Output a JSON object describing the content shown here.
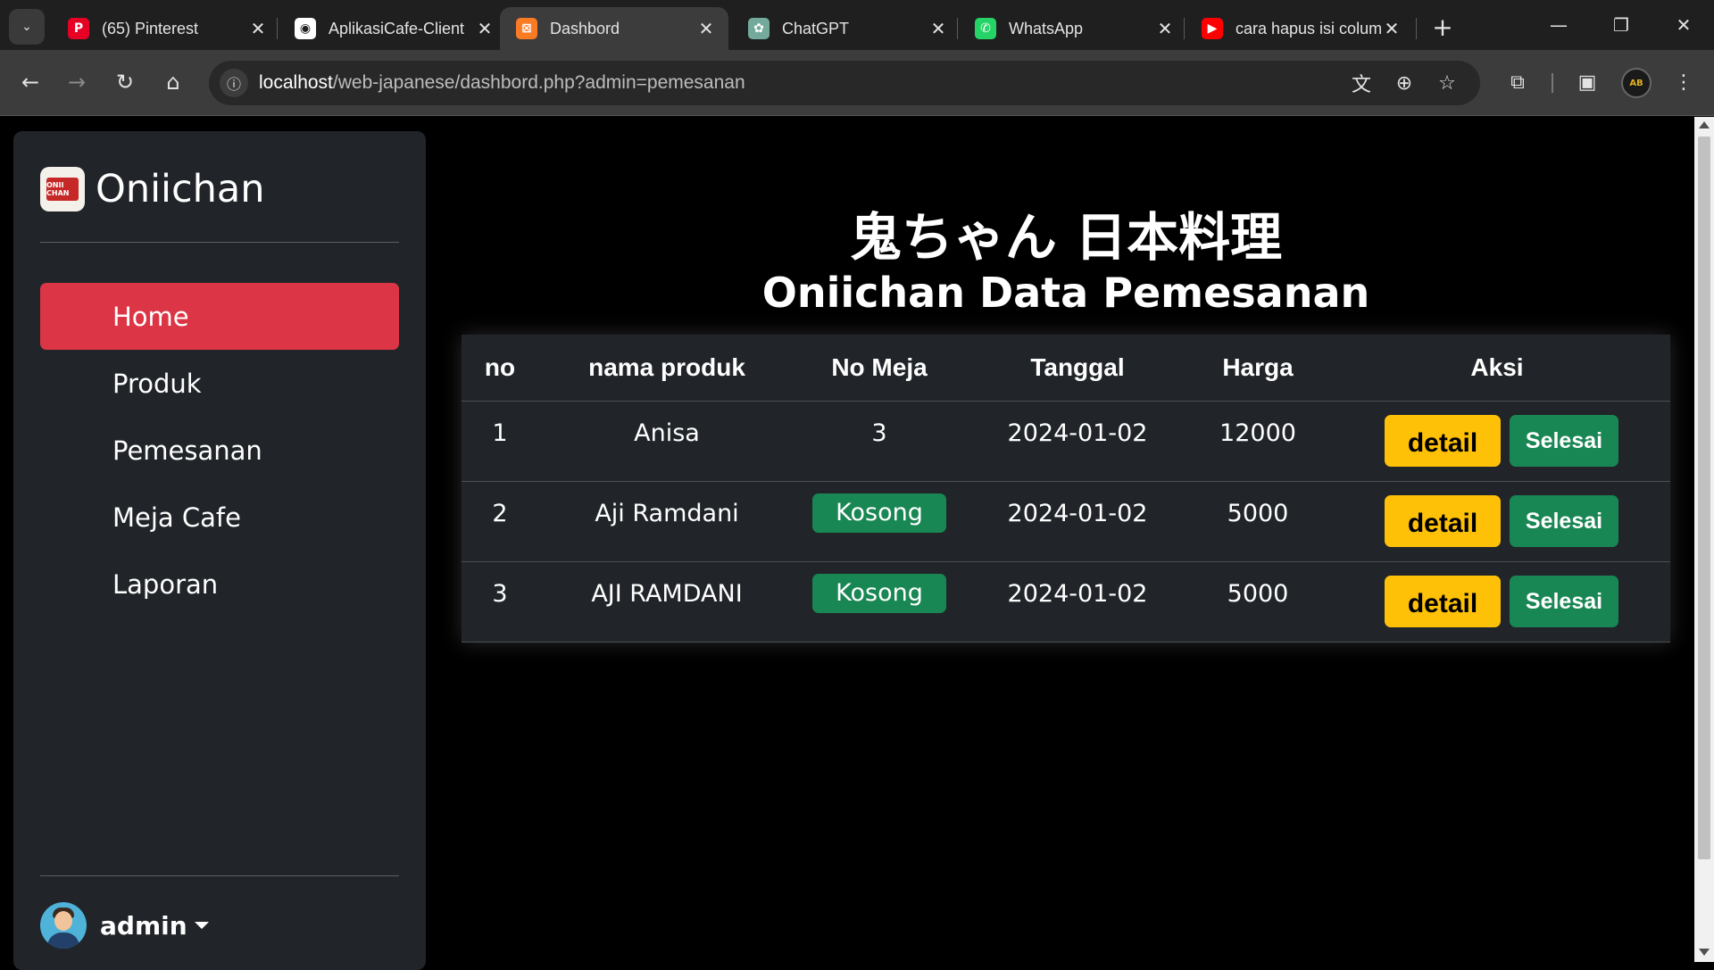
{
  "browser": {
    "tabs": [
      {
        "title": "(65) Pinterest",
        "icon": "pinterest-icon",
        "color": "#e60023"
      },
      {
        "title": "AplikasiCafe-Client",
        "icon": "github-icon",
        "color": "#ffffff"
      },
      {
        "title": "Dashbord",
        "icon": "xampp-icon",
        "color": "#fb7a24"
      },
      {
        "title": "ChatGPT",
        "icon": "chatgpt-icon",
        "color": "#74aa9c"
      },
      {
        "title": "WhatsApp",
        "icon": "whatsapp-icon",
        "color": "#25d366"
      },
      {
        "title": "cara hapus isi colum",
        "icon": "youtube-icon",
        "color": "#ff0000"
      }
    ],
    "active_tab_index": 2,
    "url_host": "localhost",
    "url_path": "/web-japanese/dashbord.php?admin=pemesanan"
  },
  "sidebar": {
    "brand": "Oniichan",
    "logo_text": "ONII CHAN",
    "menu": [
      {
        "label": "Home",
        "active": true
      },
      {
        "label": "Produk",
        "active": false
      },
      {
        "label": "Pemesanan",
        "active": false
      },
      {
        "label": "Meja Cafe",
        "active": false
      },
      {
        "label": "Laporan",
        "active": false
      }
    ],
    "user": "admin"
  },
  "main": {
    "title_jp": "鬼ちゃん 日本料理",
    "title": "Oniichan Data Pemesanan",
    "columns": [
      "no",
      "nama produk",
      "No Meja",
      "Tanggal",
      "Harga",
      "Aksi"
    ],
    "rows": [
      {
        "no": "1",
        "nama": "Anisa",
        "meja": "3",
        "meja_badge": false,
        "tanggal": "2024-01-02",
        "harga": "12000"
      },
      {
        "no": "2",
        "nama": "Aji Ramdani",
        "meja": "Kosong",
        "meja_badge": true,
        "tanggal": "2024-01-02",
        "harga": "5000"
      },
      {
        "no": "3",
        "nama": "AJI RAMDANI",
        "meja": "Kosong",
        "meja_badge": true,
        "tanggal": "2024-01-02",
        "harga": "5000"
      }
    ],
    "detail_label": "detail",
    "selesai_label": "Selesai"
  },
  "colors": {
    "accent_active": "#dc3545",
    "success": "#198754",
    "warning": "#ffc107",
    "panel": "#212529"
  }
}
